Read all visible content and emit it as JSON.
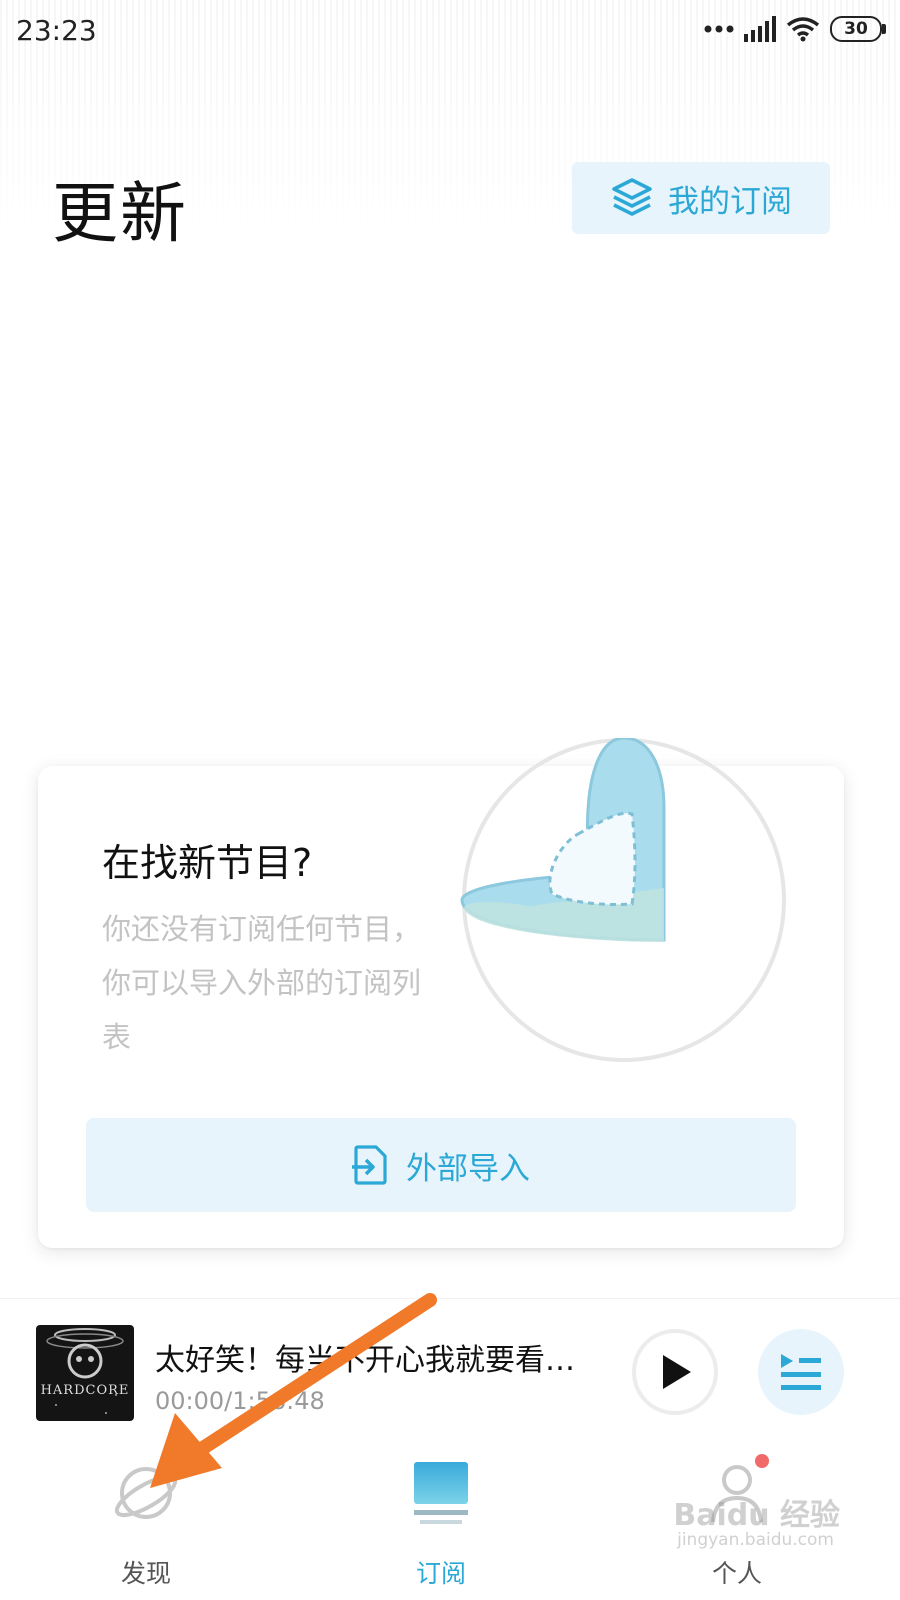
{
  "status_bar": {
    "time": "23:23",
    "battery": "30"
  },
  "header": {
    "title": "更新",
    "my_subscriptions_label": "我的订阅"
  },
  "empty_card": {
    "title": "在找新节目?",
    "description": "你还没有订阅任何节目，你可以导入外部的订阅列表",
    "import_label": "外部导入"
  },
  "player": {
    "cover_text": "HARDCORE",
    "title": "太好笑！每当不开心我就要看…",
    "time": "00:00/1:56:48"
  },
  "nav": {
    "discover_label": "发现",
    "subscribe_label": "订阅",
    "personal_label": "个人"
  },
  "watermark": {
    "brand": "Baidu 经验",
    "url": "jingyan.baidu.com"
  },
  "colors": {
    "accent": "#2ba8d6",
    "accent_bg": "#e8f4fb",
    "arrow": "#f07a2a",
    "badge": "#f06a6a"
  }
}
